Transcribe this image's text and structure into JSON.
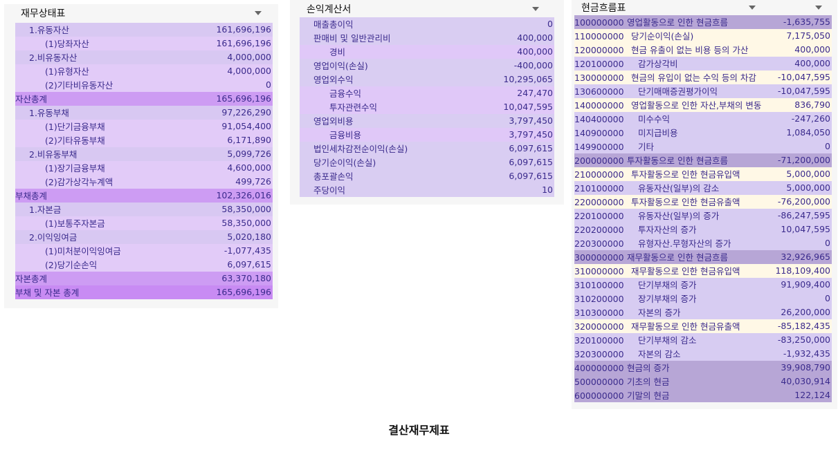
{
  "balance_sheet": {
    "title": "재무상태표",
    "rows": [
      {
        "label": "1.유동자산",
        "value": "161,696,196",
        "level": 1,
        "style": "bs-l0"
      },
      {
        "label": "(1)당좌자산",
        "value": "161,696,196",
        "level": 2,
        "style": "bs-l1"
      },
      {
        "label": "2.비유동자산",
        "value": "4,000,000",
        "level": 1,
        "style": "bs-l0"
      },
      {
        "label": "(1)유형자산",
        "value": "4,000,000",
        "level": 2,
        "style": "bs-l1"
      },
      {
        "label": "(2)기타비유동자산",
        "value": "0",
        "level": 2,
        "style": "bs-l1"
      },
      {
        "label": "자산총계",
        "value": "165,696,196",
        "level": 0,
        "style": "bs-tot"
      },
      {
        "label": "1.유동부채",
        "value": "97,226,290",
        "level": 1,
        "style": "bs-l0"
      },
      {
        "label": "(1)단기금융부채",
        "value": "91,054,400",
        "level": 2,
        "style": "bs-l1"
      },
      {
        "label": "(2)기타유동부채",
        "value": "6,171,890",
        "level": 2,
        "style": "bs-l1"
      },
      {
        "label": "2.비유동부채",
        "value": "5,099,726",
        "level": 1,
        "style": "bs-l0"
      },
      {
        "label": "(1)장기금융부채",
        "value": "4,600,000",
        "level": 2,
        "style": "bs-l1"
      },
      {
        "label": "(2)감가상각누계액",
        "value": "499,726",
        "level": 2,
        "style": "bs-l1"
      },
      {
        "label": "부채총계",
        "value": "102,326,016",
        "level": 0,
        "style": "bs-tot"
      },
      {
        "label": "1.자본금",
        "value": "58,350,000",
        "level": 1,
        "style": "bs-l0"
      },
      {
        "label": "(1)보통주자본금",
        "value": "58,350,000",
        "level": 2,
        "style": "bs-l1"
      },
      {
        "label": "2.이익잉여금",
        "value": "5,020,180",
        "level": 1,
        "style": "bs-l0"
      },
      {
        "label": "(1)미처분이익잉여금",
        "value": "-1,077,435",
        "level": 2,
        "style": "bs-l1"
      },
      {
        "label": "(2)당기순손익",
        "value": "6,097,615",
        "level": 2,
        "style": "bs-l1"
      },
      {
        "label": "자본총계",
        "value": "63,370,180",
        "level": 0,
        "style": "bs-tot"
      },
      {
        "label": "부채 및 자본 총계",
        "value": "165,696,196",
        "level": 0,
        "style": "bs-grand"
      }
    ]
  },
  "income_statement": {
    "title": "손익계산서",
    "rows": [
      {
        "label": "매출총이익",
        "value": "0",
        "level": 1,
        "style": "is-a"
      },
      {
        "label": "판매비 및 일반관리비",
        "value": "400,000",
        "level": 1,
        "style": "is-a"
      },
      {
        "label": "경비",
        "value": "400,000",
        "level": 2,
        "style": "is-b"
      },
      {
        "label": "영업이익(손실)",
        "value": "-400,000",
        "level": 1,
        "style": "is-a"
      },
      {
        "label": "영업외수익",
        "value": "10,295,065",
        "level": 1,
        "style": "is-a"
      },
      {
        "label": "금융수익",
        "value": "247,470",
        "level": 2,
        "style": "is-b"
      },
      {
        "label": "투자관련수익",
        "value": "10,047,595",
        "level": 2,
        "style": "is-b"
      },
      {
        "label": "영업외비용",
        "value": "3,797,450",
        "level": 1,
        "style": "is-a"
      },
      {
        "label": "금융비용",
        "value": "3,797,450",
        "level": 2,
        "style": "is-b"
      },
      {
        "label": "법인세차감전순이익(손실)",
        "value": "6,097,615",
        "level": 1,
        "style": "is-a"
      },
      {
        "label": "당기순이익(손실)",
        "value": "6,097,615",
        "level": 1,
        "style": "is-a"
      },
      {
        "label": "총포괄손익",
        "value": "6,097,615",
        "level": 1,
        "style": "is-a"
      },
      {
        "label": "주당이익",
        "value": "10",
        "level": 1,
        "style": "is-a"
      }
    ]
  },
  "cash_flow": {
    "title": "현금흐름표",
    "rows": [
      {
        "code": "100000000",
        "label": "영업활동으로 인한 현금흐름",
        "value": "-1,635,755",
        "level": 0,
        "style": "cf-main"
      },
      {
        "code": "110000000",
        "label": "당기순이익(손실)",
        "value": "7,175,050",
        "level": 1,
        "style": "cf-sub"
      },
      {
        "code": "120000000",
        "label": "현금 유출이 없는 비용 등의 가산",
        "value": "400,000",
        "level": 1,
        "style": "cf-sub"
      },
      {
        "code": "120100000",
        "label": "감가상각비",
        "value": "400,000",
        "level": 2,
        "style": "cf-det"
      },
      {
        "code": "130000000",
        "label": "현금의 유입이 없는 수익 등의 차감",
        "value": "-10,047,595",
        "level": 1,
        "style": "cf-sub"
      },
      {
        "code": "130600000",
        "label": "단기매매증권평가이익",
        "value": "-10,047,595",
        "level": 2,
        "style": "cf-det"
      },
      {
        "code": "140000000",
        "label": "영업활동으로 인한 자산,부채의 변동",
        "value": "836,790",
        "level": 1,
        "style": "cf-sub"
      },
      {
        "code": "140400000",
        "label": "미수수익",
        "value": "-247,260",
        "level": 2,
        "style": "cf-det"
      },
      {
        "code": "140900000",
        "label": "미지급비용",
        "value": "1,084,050",
        "level": 2,
        "style": "cf-det"
      },
      {
        "code": "149900000",
        "label": "기타",
        "value": "0",
        "level": 2,
        "style": "cf-det"
      },
      {
        "code": "200000000",
        "label": "투자활동으로 인한 현금흐름",
        "value": "-71,200,000",
        "level": 0,
        "style": "cf-main"
      },
      {
        "code": "210000000",
        "label": "투자활동으로 인한 현금유입액",
        "value": "5,000,000",
        "level": 1,
        "style": "cf-sub"
      },
      {
        "code": "210100000",
        "label": "유동자산(일부)의 감소",
        "value": "5,000,000",
        "level": 2,
        "style": "cf-det"
      },
      {
        "code": "220000000",
        "label": "투자활동으로 인한 현금유출액",
        "value": "-76,200,000",
        "level": 1,
        "style": "cf-sub"
      },
      {
        "code": "220100000",
        "label": "유동자산(일부)의 증가",
        "value": "-86,247,595",
        "level": 2,
        "style": "cf-det"
      },
      {
        "code": "220200000",
        "label": "투자자산의 증가",
        "value": "10,047,595",
        "level": 2,
        "style": "cf-det"
      },
      {
        "code": "220300000",
        "label": "유형자산.무형자산의 증가",
        "value": "0",
        "level": 2,
        "style": "cf-det"
      },
      {
        "code": "300000000",
        "label": "재무활동으로 인한 현금흐름",
        "value": "32,926,965",
        "level": 0,
        "style": "cf-main"
      },
      {
        "code": "310000000",
        "label": "재무활동으로 인한 현금유입액",
        "value": "118,109,400",
        "level": 1,
        "style": "cf-sub"
      },
      {
        "code": "310100000",
        "label": "단기부채의 증가",
        "value": "91,909,400",
        "level": 2,
        "style": "cf-det"
      },
      {
        "code": "310200000",
        "label": "장기부채의 증가",
        "value": "0",
        "level": 2,
        "style": "cf-det"
      },
      {
        "code": "310300000",
        "label": "자본의 증가",
        "value": "26,200,000",
        "level": 2,
        "style": "cf-det"
      },
      {
        "code": "320000000",
        "label": "재무활동으로 인한 현금유출액",
        "value": "-85,182,435",
        "level": 1,
        "style": "cf-sub"
      },
      {
        "code": "320100000",
        "label": "단기부채의 감소",
        "value": "-83,250,000",
        "level": 2,
        "style": "cf-det"
      },
      {
        "code": "320300000",
        "label": "자본의 감소",
        "value": "-1,932,435",
        "level": 2,
        "style": "cf-det"
      },
      {
        "code": "400000000",
        "label": "현금의 증가",
        "value": "39,908,790",
        "level": 0,
        "style": "cf-main"
      },
      {
        "code": "500000000",
        "label": "기초의 현금",
        "value": "40,030,914",
        "level": 0,
        "style": "cf-main"
      },
      {
        "code": "600000000",
        "label": "기말의 현금",
        "value": "122,124",
        "level": 0,
        "style": "cf-main"
      }
    ]
  },
  "caption": "결산재무제표",
  "colors": {
    "text": "#3a2a8c",
    "bs_row": "#d8c8f2",
    "bs_subrow": "#e2cbf8",
    "bs_total": "#cd9cf3",
    "cf_main": "#b7a6d6",
    "cf_sub": "#fff8e6",
    "cf_detail": "#d7ccf2"
  },
  "icons": {
    "dropdown": "chevron-down-icon"
  }
}
